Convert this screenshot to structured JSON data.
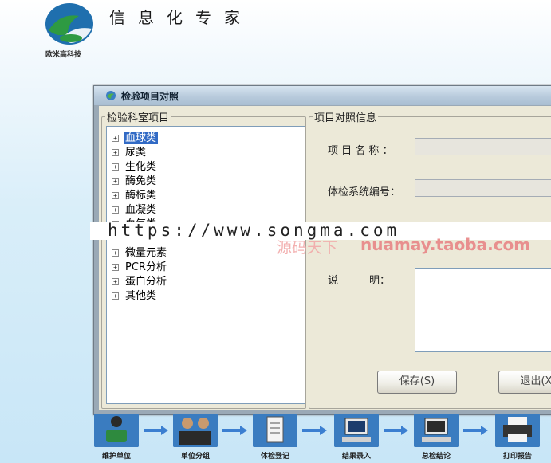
{
  "header": {
    "company": "欧米高科技",
    "title": "信息化专家"
  },
  "dialog": {
    "title": "检验项目对照",
    "left_group": {
      "legend": "检验科室项目",
      "items": [
        {
          "label": "血球类",
          "selected": true
        },
        {
          "label": "尿类"
        },
        {
          "label": "生化类"
        },
        {
          "label": "酶免类"
        },
        {
          "label": "酶标类"
        },
        {
          "label": "血凝类"
        },
        {
          "label": "血气类"
        },
        {
          "label": "微量元素"
        },
        {
          "label": "PCR分析"
        },
        {
          "label": "蛋白分析"
        },
        {
          "label": "其他类"
        }
      ]
    },
    "right_group": {
      "legend": "项目对照信息",
      "item_name_label": "项 目 名 称 ：",
      "item_name_value": "",
      "exam_code_label": "体检系统编号：",
      "exam_code_value": "",
      "description_label": "说　　　明：",
      "description_value": "",
      "save_button": "保存(S)",
      "exit_button": "退出(X)"
    }
  },
  "watermark": {
    "url": "https://www.songma.com",
    "cn": "源码天下",
    "en": "nuamay.taoba.com"
  },
  "workflow": {
    "steps": [
      {
        "label": "维护单位"
      },
      {
        "label": "单位分组"
      },
      {
        "label": "体检登记"
      },
      {
        "label": "结果录入"
      },
      {
        "label": "总检结论"
      },
      {
        "label": "打印报告"
      }
    ]
  },
  "colors": {
    "selection": "#316ac5",
    "dialog_face": "#ece9d8",
    "flow_icon": "#2c6db5",
    "arrow": "#3b7fd1"
  }
}
